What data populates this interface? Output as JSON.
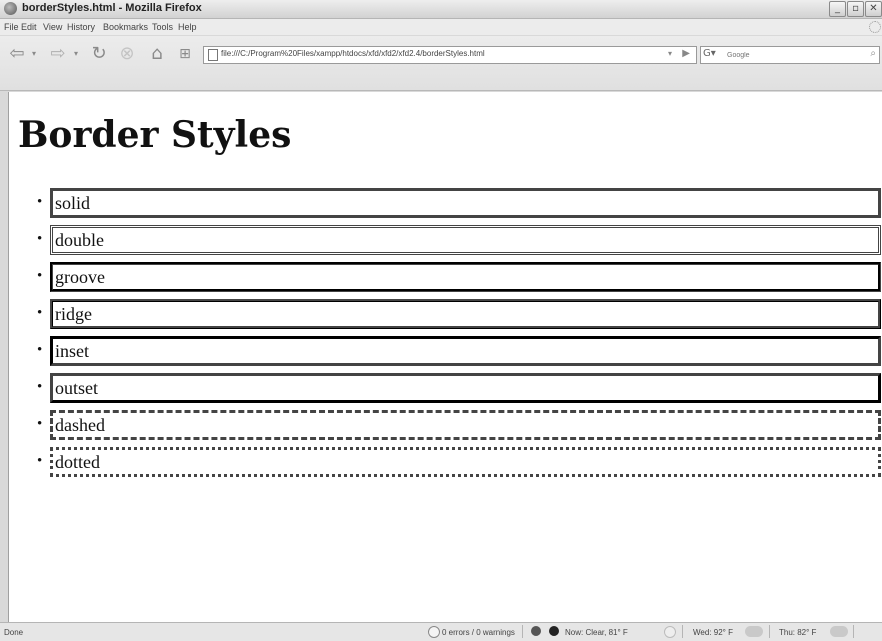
{
  "window": {
    "title": "borderStyles.html - Mozilla Firefox",
    "controls": {
      "minimize": "_",
      "maximize": "▫",
      "close": "✕"
    }
  },
  "menu": {
    "items": [
      "File",
      "Edit",
      "View",
      "History",
      "Bookmarks",
      "Tools",
      "Help"
    ]
  },
  "toolbar": {
    "url": "file:///C:/Program%20Files/xampp/htdocs/xfd/xfd2/xfd2.4/borderStyles.html",
    "search_placeholder": "Google",
    "search_engine_icon": "G",
    "icons": [
      "back-icon",
      "forward-icon",
      "reload-icon",
      "stop-icon",
      "home-icon",
      "new-tab-icon"
    ]
  },
  "page": {
    "heading": "Border Styles",
    "border_color": "#444444",
    "items": [
      {
        "label": "solid",
        "style": "solid"
      },
      {
        "label": "double",
        "style": "double"
      },
      {
        "label": "groove",
        "style": "groove"
      },
      {
        "label": "ridge",
        "style": "ridge"
      },
      {
        "label": "inset",
        "style": "inset"
      },
      {
        "label": "outset",
        "style": "outset"
      },
      {
        "label": "dashed",
        "style": "dashed"
      },
      {
        "label": "dotted",
        "style": "dotted"
      }
    ]
  },
  "status": {
    "left": "Done",
    "errors": "0 errors / 0 warnings",
    "now": "Now: Clear, 81° F",
    "wed": "Wed: 92° F",
    "thu": "Thu: 82° F"
  }
}
